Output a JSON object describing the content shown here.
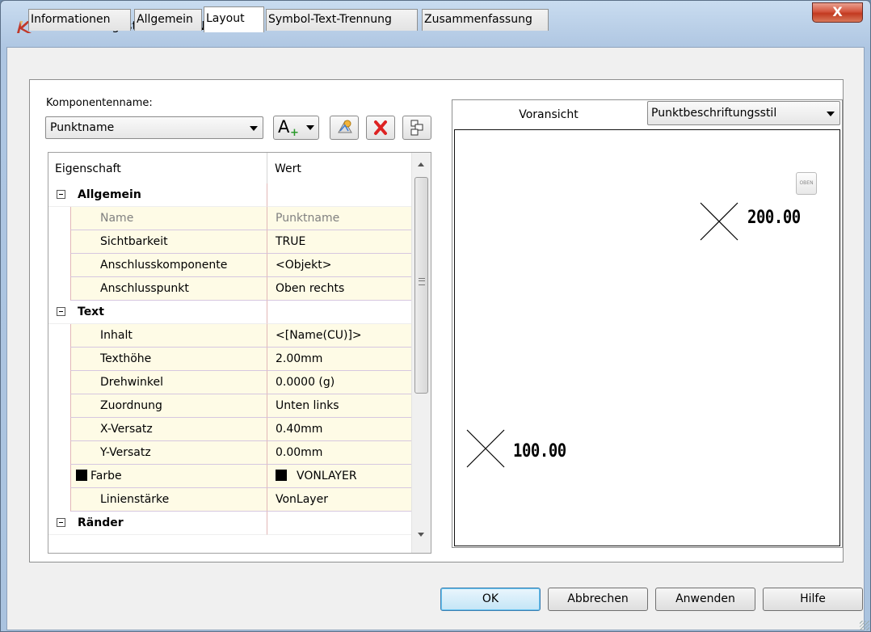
{
  "window": {
    "title": "Beschriftungsstil-Editor - NZ",
    "close_label": "X"
  },
  "tabs": [
    {
      "label": "Informationen",
      "active": false
    },
    {
      "label": "Allgemein",
      "active": false
    },
    {
      "label": "Layout",
      "active": true
    },
    {
      "label": "Symbol-Text-Trennung",
      "active": false
    },
    {
      "label": "Zusammenfassung",
      "active": false
    }
  ],
  "component": {
    "label": "Komponentenname:",
    "value": "Punktname"
  },
  "toolbar": {
    "add_icon_text": "A",
    "icons": [
      "add-text-component-icon",
      "copy-component-icon",
      "delete-component-icon",
      "component-draw-order-icon"
    ]
  },
  "grid": {
    "header_property": "Eigenschaft",
    "header_value": "Wert",
    "rows": [
      {
        "type": "category",
        "label": "Allgemein"
      },
      {
        "type": "property",
        "label": "Name",
        "value": "Punktname",
        "dim": true
      },
      {
        "type": "property",
        "label": "Sichtbarkeit",
        "value": "TRUE"
      },
      {
        "type": "property",
        "label": "Anschlusskomponente",
        "value": "<Objekt>"
      },
      {
        "type": "property",
        "label": "Anschlusspunkt",
        "value": "Oben rechts"
      },
      {
        "type": "category",
        "label": "Text"
      },
      {
        "type": "property",
        "label": "Inhalt",
        "value": "<[Name(CU)]>"
      },
      {
        "type": "property",
        "label": "Texthöhe",
        "value": "2.00mm"
      },
      {
        "type": "property",
        "label": "Drehwinkel",
        "value": "0.0000 (g)"
      },
      {
        "type": "property",
        "label": "Zuordnung",
        "value": "Unten links"
      },
      {
        "type": "property",
        "label": "X-Versatz",
        "value": "0.40mm"
      },
      {
        "type": "property",
        "label": "Y-Versatz",
        "value": "0.00mm"
      },
      {
        "type": "property",
        "label": "Farbe",
        "value": "VONLAYER",
        "swatch": "#000000"
      },
      {
        "type": "property",
        "label": "Linienstärke",
        "value": "VonLayer"
      },
      {
        "type": "category",
        "label": "Ränder"
      }
    ]
  },
  "preview": {
    "header_label": "Voransicht",
    "style_value": "Punktbeschriftungsstil",
    "labels": [
      {
        "text": "200.00"
      },
      {
        "text": "100.00"
      }
    ],
    "oben_icon_text": "OBEN"
  },
  "buttons": {
    "ok": "OK",
    "cancel": "Abbrechen",
    "apply": "Anwenden",
    "help": "Hilfe"
  },
  "colors": {
    "grid_value_bg": "#fefbe6",
    "close_red": "#c23a20",
    "ok_accent": "#3c7fb1"
  }
}
